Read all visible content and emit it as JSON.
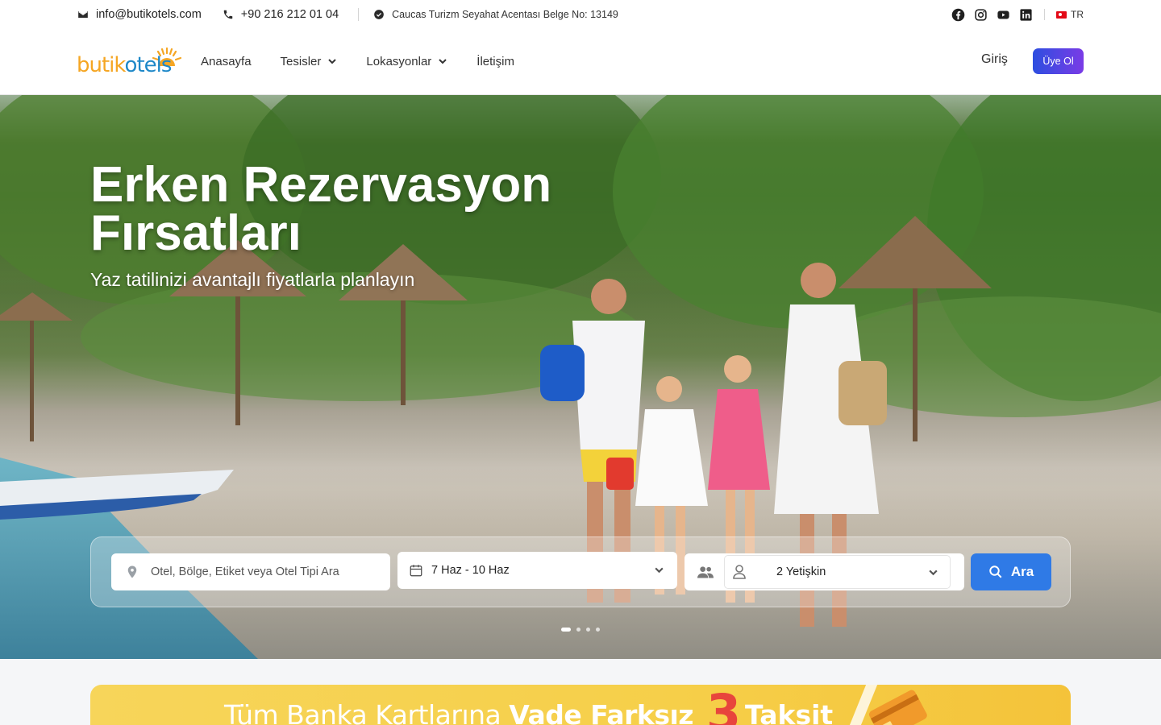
{
  "topbar": {
    "email": "info@butikotels.com",
    "phone": "+90 216 212 01 04",
    "license": "Caucas Turizm Seyahat Acentası Belge No: 13149",
    "language": "TR",
    "social_icons": [
      "facebook-icon",
      "instagram-icon",
      "youtube-icon",
      "linkedin-icon"
    ]
  },
  "nav": {
    "logo_part1": "butik",
    "logo_part2": "otels",
    "items": [
      {
        "label": "Anasayfa",
        "dropdown": false
      },
      {
        "label": "Tesisler",
        "dropdown": true
      },
      {
        "label": "Lokasyonlar",
        "dropdown": true
      },
      {
        "label": "İletişim",
        "dropdown": false
      }
    ],
    "login_label": "Giriş",
    "signup_label": "Üye Ol"
  },
  "hero": {
    "title": "Erken Rezervasyon Fırsatları",
    "subtitle": "Yaz tatilinizi avantajlı fiyatlarla planlayın",
    "slides_count": 4,
    "active_slide": 1
  },
  "search": {
    "location_placeholder": "Otel, Bölge, Etiket veya Otel Tipi Ara",
    "location_value": "",
    "dates": "7 Haz - 10 Haz",
    "guests": "2 Yetişkin",
    "button_label": "Ara"
  },
  "promo": {
    "text_light": "Tüm Banka Kartlarına ",
    "text_bold": "Vade Farksız",
    "number": "3",
    "text_end": "Taksit"
  },
  "colors": {
    "primary": "#2f7ae6",
    "signup_gradient_start": "#2d4ee0",
    "signup_gradient_end": "#7a3be6",
    "logo_orange": "#f5a623",
    "logo_blue": "#1e88c8",
    "promo_yellow": "#f6cf49",
    "promo_red": "#e8453c"
  }
}
